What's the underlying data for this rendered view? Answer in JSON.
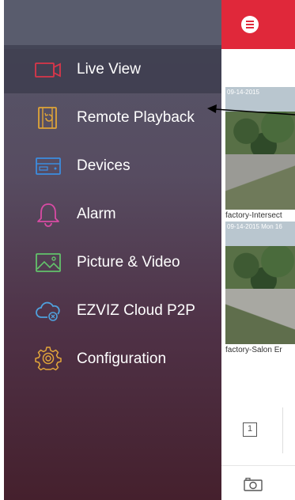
{
  "app": {
    "cameras": [
      {
        "label": "factory-Intersect",
        "stamp": "09-14-2015"
      },
      {
        "label": "factory-Salon Er",
        "stamp": "09-14-2015 Mon 16"
      }
    ],
    "split_label": "1"
  },
  "drawer": {
    "items": [
      {
        "label": "Live View",
        "icon": "video-camera-icon",
        "active": true,
        "color": "#d9364a"
      },
      {
        "label": "Remote Playback",
        "icon": "playback-film-icon",
        "active": false,
        "color": "#e0a437"
      },
      {
        "label": "Devices",
        "icon": "dvr-device-icon",
        "active": false,
        "color": "#3c8ddf"
      },
      {
        "label": "Alarm",
        "icon": "bell-icon",
        "active": false,
        "color": "#d94ba4"
      },
      {
        "label": "Picture & Video",
        "icon": "picture-icon",
        "active": false,
        "color": "#63c26b"
      },
      {
        "label": "EZVIZ Cloud P2P",
        "icon": "cloud-p2p-icon",
        "active": false,
        "color": "#4fa0dc"
      },
      {
        "label": "Configuration",
        "icon": "gear-icon",
        "active": false,
        "color": "#e3a63a"
      }
    ]
  },
  "colors": {
    "accent": "#e0283a"
  }
}
